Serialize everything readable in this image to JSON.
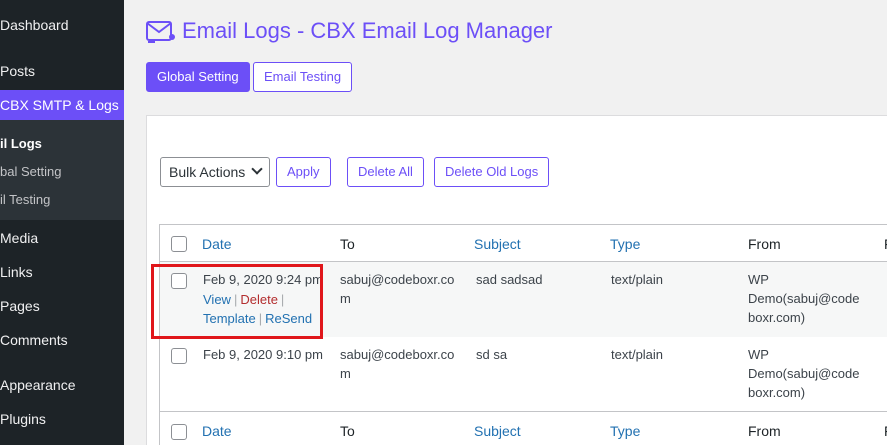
{
  "sidebar": {
    "items": [
      {
        "label": "Dashboard"
      },
      {
        "label": "Posts"
      },
      {
        "label": "CBX SMTP & Logs"
      },
      {
        "label": "Media"
      },
      {
        "label": "Links"
      },
      {
        "label": "Pages"
      },
      {
        "label": "Comments"
      },
      {
        "label": "Appearance"
      },
      {
        "label": "Plugins"
      }
    ],
    "submenu": [
      {
        "label": "il Logs"
      },
      {
        "label": "bal Setting"
      },
      {
        "label": "il Testing"
      }
    ]
  },
  "header": {
    "title": "Email Logs - CBX Email Log Manager",
    "icon": "mail-icon"
  },
  "tabs": {
    "global_setting": "Global Setting",
    "email_testing": "Email Testing"
  },
  "toolbar": {
    "bulk_actions": "Bulk Actions",
    "apply": "Apply",
    "delete_all": "Delete All",
    "delete_old_logs": "Delete Old Logs"
  },
  "table": {
    "columns": [
      "Date",
      "To",
      "Subject",
      "Type",
      "From",
      "F"
    ],
    "rows": [
      {
        "date": "Feb 9, 2020 9:24 pm",
        "to_1": "sabuj@codeboxr.co",
        "to_2": "m",
        "subject": "sad sadsad",
        "type": "text/plain",
        "from_1": "WP",
        "from_2": "Demo(sabuj@code",
        "from_3": "boxr.com)",
        "actions": {
          "view": "View",
          "delete": "Delete",
          "template": "Template",
          "resend": "ReSend"
        }
      },
      {
        "date": "Feb 9, 2020 9:10 pm",
        "to_1": "sabuj@codeboxr.co",
        "to_2": "m",
        "subject": "sd sa",
        "type": "text/plain",
        "from_1": "WP",
        "from_2": "Demo(sabuj@code",
        "from_3": "boxr.com)"
      }
    ]
  },
  "colors": {
    "accent": "#6c4ff7",
    "sidebar_bg": "#1d2327",
    "link": "#2271b1",
    "delete": "#b32d2e",
    "highlight": "#e0161b"
  }
}
